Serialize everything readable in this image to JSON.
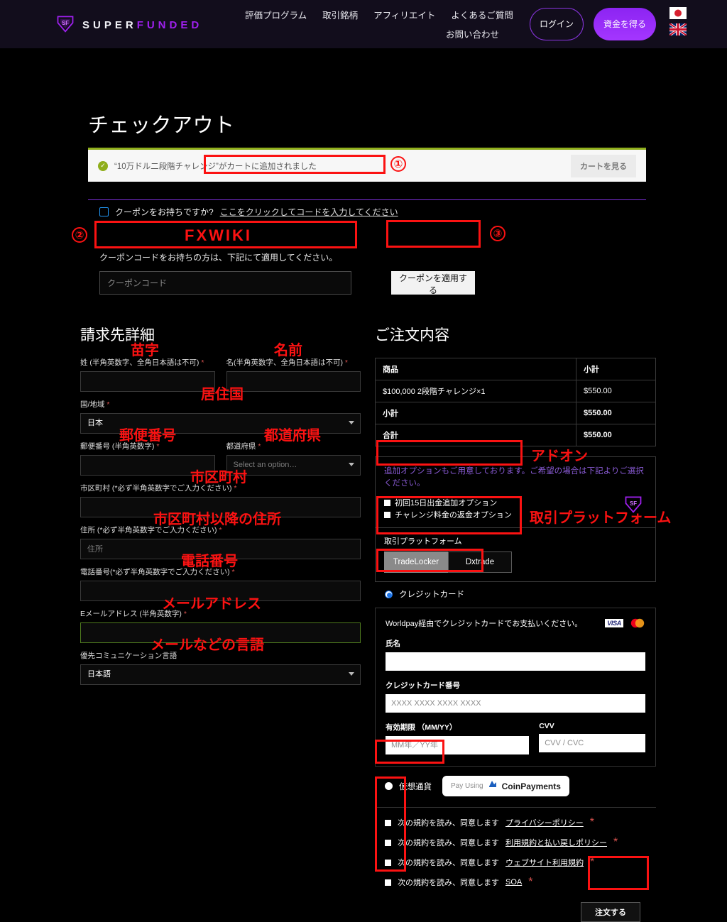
{
  "header": {
    "logo": {
      "text_white": "SUPER",
      "text_purple": "FUNDED",
      "icon": "shield-sf-logo"
    },
    "nav": [
      {
        "label": "評価プログラム"
      },
      {
        "label": "取引銘柄"
      },
      {
        "label": "アフィリエイト"
      },
      {
        "label": "よくあるご質問"
      },
      {
        "label": "お問い合わせ"
      }
    ],
    "login_label": "ログイン",
    "get_funded_label": "資金を得る",
    "flags": [
      {
        "name": "japan-flag"
      },
      {
        "name": "uk-flag"
      }
    ]
  },
  "page": {
    "title": "チェックアウト",
    "cart_notice": {
      "text": "“10万ドル二段階チャレンジ”がカートに追加されました",
      "button": "カートを見る"
    },
    "coupon": {
      "question": "クーポンをお持ちですか?",
      "link": "ここをクリックしてコードを入力してください",
      "note": "クーポンコードをお持ちの方は、下記にて適用してください。",
      "input_placeholder": "クーポンコード",
      "input_value": "",
      "apply_label": "クーポンを適用する"
    }
  },
  "billing": {
    "title": "請求先詳細",
    "fields": {
      "last_name_label": "姓 (半角英数字、全角日本語は不可)",
      "first_name_label": "名(半角英数字、全角日本語は不可)",
      "country_label": "国/地域",
      "country_value": "日本",
      "postcode_label": "郵便番号 (半角英数字)",
      "state_label": "都道府県",
      "state_placeholder": "Select an option…",
      "city_label": "市区町村 (*必ず半角英数字でご入力ください)",
      "address_label": "住所 (*必ず半角英数字でご入力ください)",
      "address_placeholder": "住所",
      "phone_label": "電話番号(*必ず半角英数字でご入力ください)",
      "email_label": "Eメールアドレス (半角英数字)",
      "lang_label": "優先コミュニケーション言語",
      "lang_value": "日本語"
    }
  },
  "order": {
    "title": "ご注文内容",
    "table": {
      "headers": [
        "商品",
        "小計"
      ],
      "rows": [
        {
          "label": "$100,000 2段階チャレンジ×1",
          "value": "$550.00",
          "bold": false
        },
        {
          "label": "小計",
          "value": "$550.00",
          "bold": true
        },
        {
          "label": "合計",
          "value": "$550.00",
          "bold": true
        }
      ]
    },
    "addon_note": "追加オプションもご用意しております。ご希望の場合は下記よりご選択ください。",
    "addons": [
      {
        "label": "初回15日出金追加オプション"
      },
      {
        "label": "チャレンジ料金の返金オプション"
      }
    ],
    "platform_label": "取引プラットフォーム",
    "platforms": [
      {
        "label": "TradeLocker",
        "selected": true
      },
      {
        "label": "Dxtrade",
        "selected": false
      }
    ],
    "payment": {
      "credit_card_label": "クレジットカード",
      "crypto_label": "仮想通貨",
      "coin_using": "Pay Using",
      "coin_name": "CoinPayments",
      "cc_note": "Worldpay経由でクレジットカードでお支払いください。",
      "cc_name_label": "氏名",
      "cc_name_value": "",
      "cc_number_label": "クレジットカード番号",
      "cc_number_placeholder": "XXXX XXXX XXXX XXXX",
      "cc_expiry_label": "有効期限 （MM/YY）",
      "cc_expiry_placeholder": "MM年／YY年",
      "cc_cvv_label": "CVV",
      "cc_cvv_placeholder": "CVV / CVC",
      "card_brands": [
        "VISA",
        "mastercard"
      ]
    },
    "terms_prefix": "次の規約を読み、同意します",
    "terms": [
      {
        "link": "プライバシーポリシー"
      },
      {
        "link": "利用規約と払い戻しポリシー"
      },
      {
        "link": "ウェブサイト利用規約"
      },
      {
        "link": "SOA"
      }
    ],
    "submit_label": "注文する"
  },
  "annotations": {
    "n1": "①",
    "n2": "②",
    "n3": "③",
    "coupon_value_overlay": "FXWIKI",
    "last_name": "苗字",
    "first_name": "名前",
    "country": "居住国",
    "postcode": "郵便番号",
    "state": "都道府県",
    "city": "市区町村",
    "address": "市区町村以降の住所",
    "phone": "電話番号",
    "email": "メールアドレス",
    "lang": "メールなどの言語",
    "addon": "アドオン",
    "platform": "取引プラットフォーム"
  },
  "colors": {
    "accent_purple": "#a020f0",
    "annotation_red": "#fb1212",
    "notice_green": "#8fae1b",
    "header_bg": "#120d1c"
  }
}
